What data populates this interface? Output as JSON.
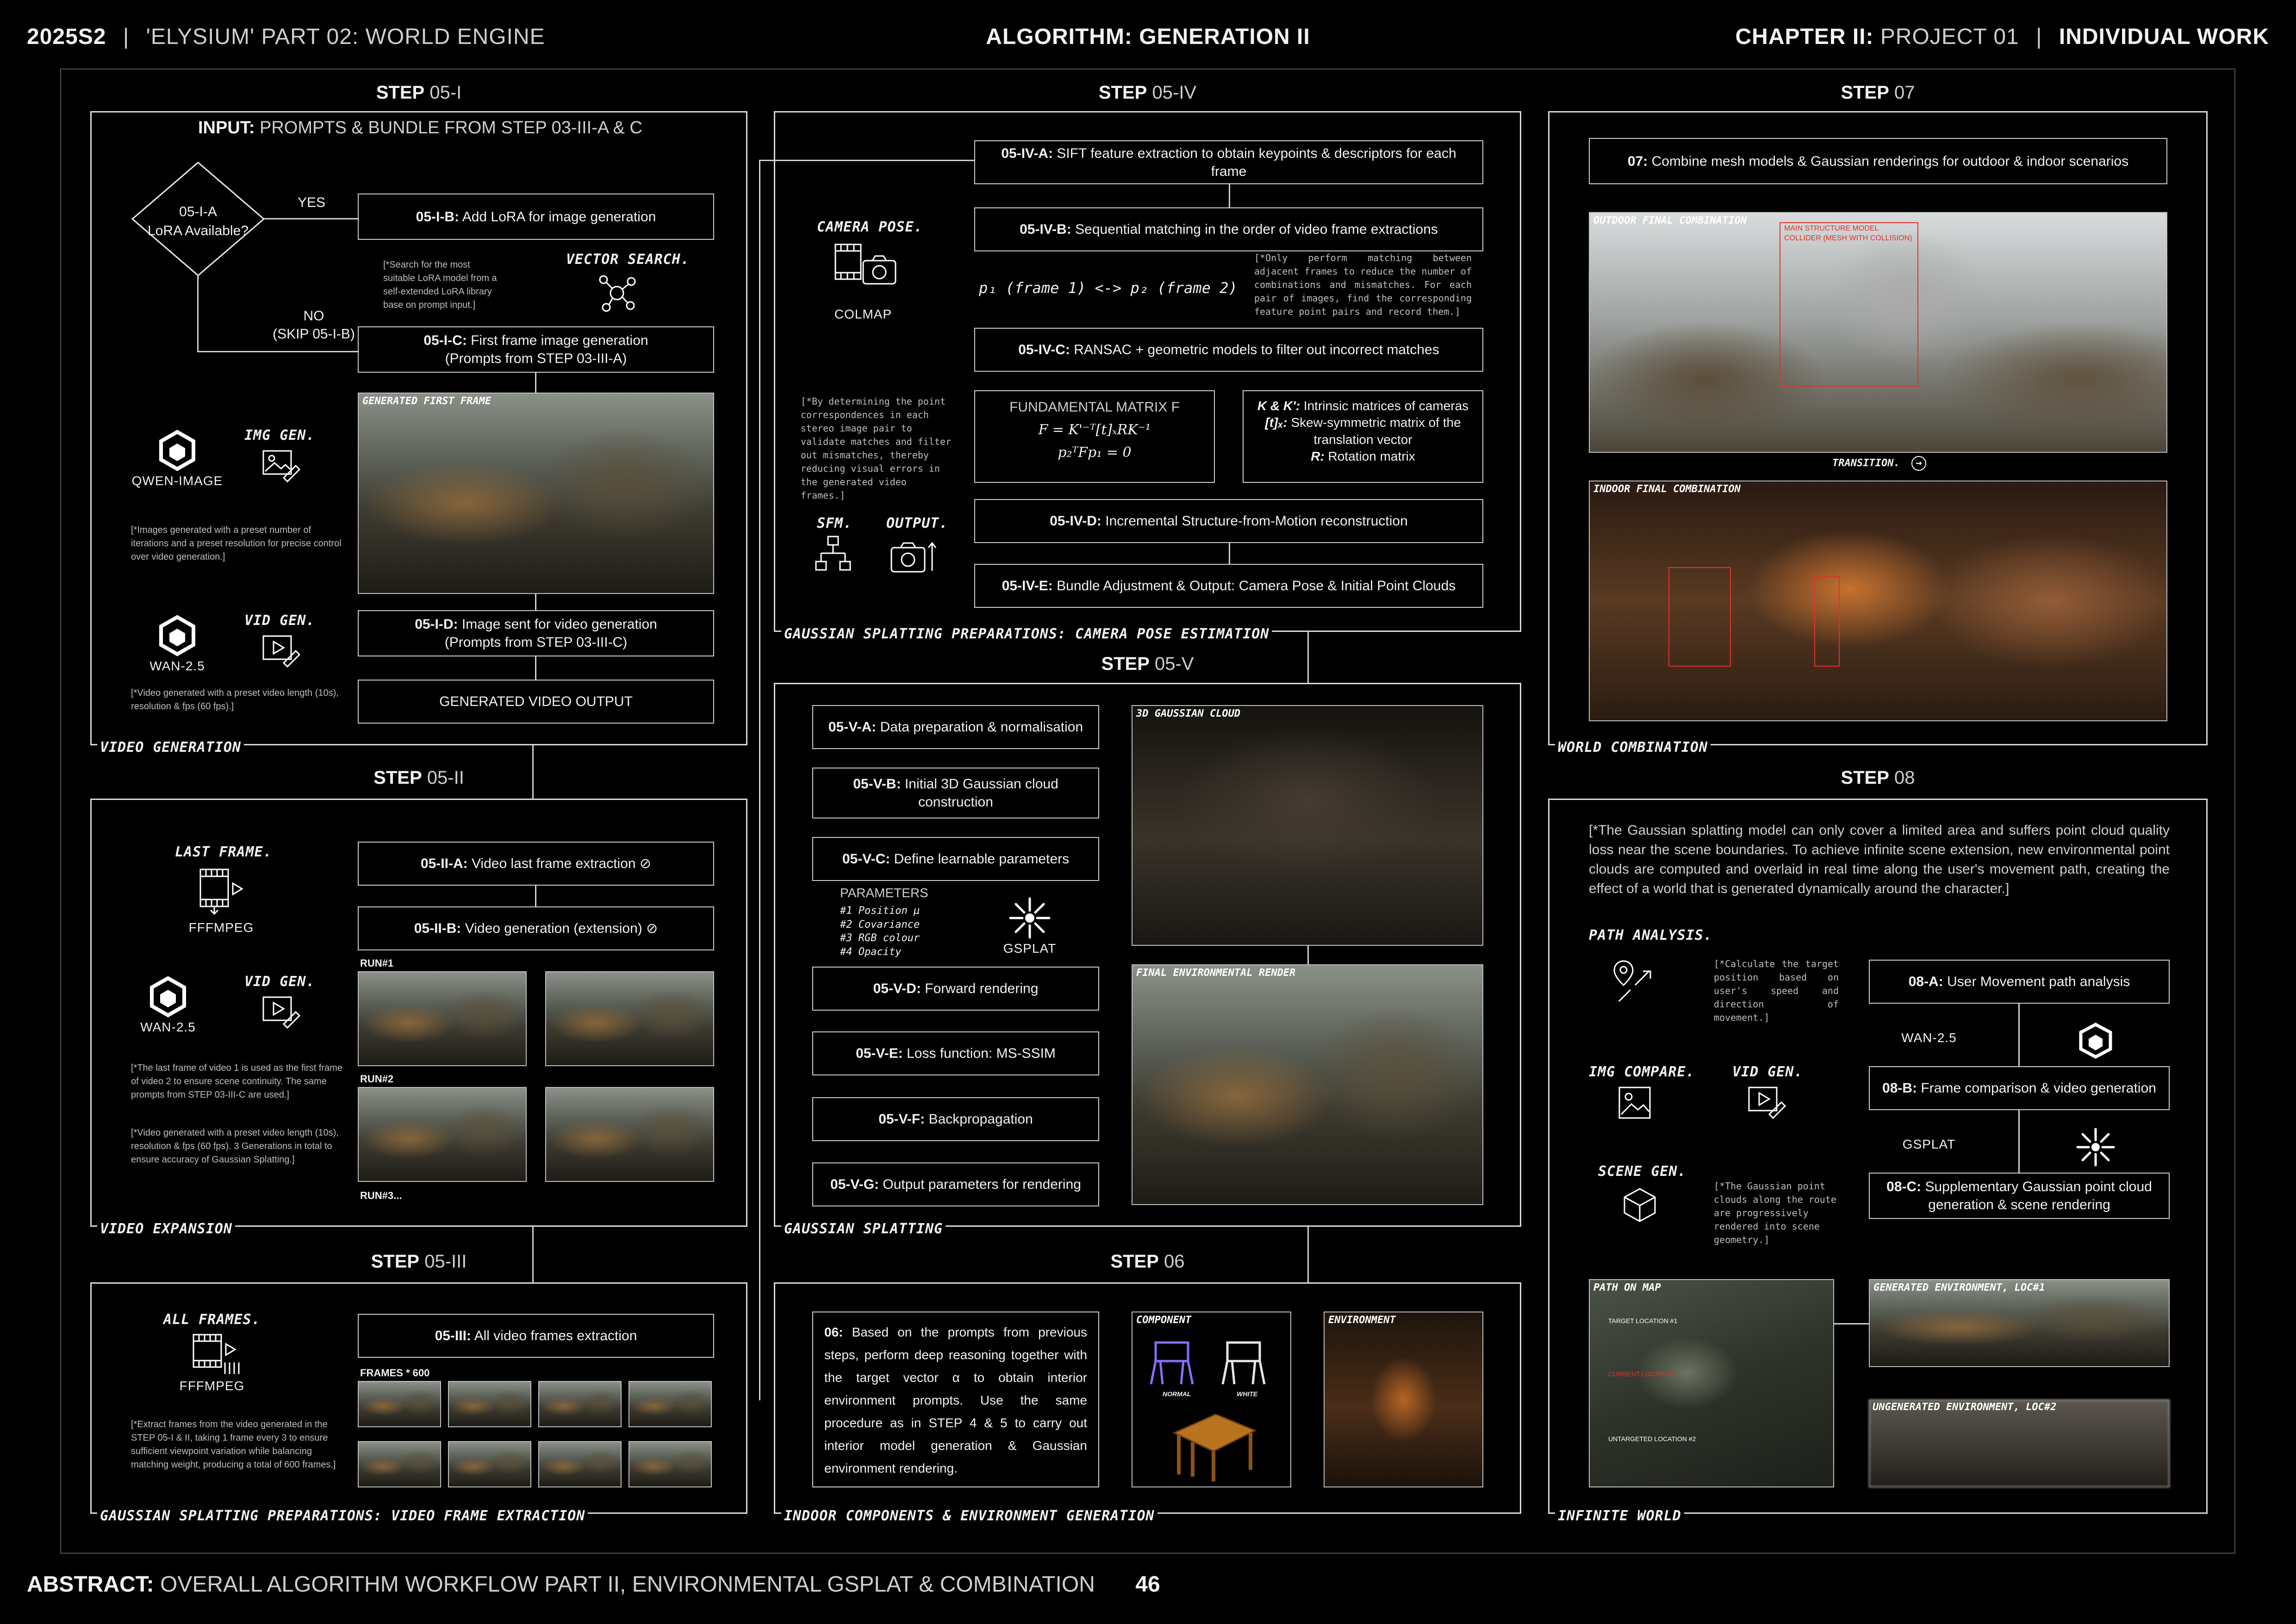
{
  "header": {
    "left_code": "2025S2",
    "left_sep": "|",
    "left_title_bold": "'ELYSIUM' PART 02:",
    "left_title_light": "WORLD ENGINE",
    "center": "ALGORITHM: GENERATION II",
    "right_bold": "CHAPTER II:",
    "right_light": "PROJECT 01",
    "right_sep": "|",
    "right_tag": "INDIVIDUAL WORK"
  },
  "footer": {
    "abstract_bold": "ABSTRACT:",
    "abstract_text": "OVERALL ALGORITHM WORKFLOW PART II, ENVIRONMENTAL GSPLAT & COMBINATION",
    "page": "46"
  },
  "step_05_i": {
    "step": "STEP",
    "num": "05-I",
    "input_bold": "INPUT:",
    "input_text": "PROMPTS & BUNDLE FROM STEP 03-III-A & C",
    "decision_line1": "05-I-A",
    "decision_line2": "LoRA Available?",
    "yes": "YES",
    "no": "NO",
    "skip": "(SKIP 05-I-B)",
    "box_b_code": "05-I-B:",
    "box_b_text": "Add LoRA for image generation",
    "vector_search": "VECTOR SEARCH.",
    "lora_note": "[*Search for the most suitable LoRA model from a self-extended LoRA library base on prompt input.]",
    "box_c_code": "05-I-C:",
    "box_c_text": "First frame image generation",
    "box_c_sub": "(Prompts from STEP 03-III-A)",
    "img_tag": "GENERATED FIRST FRAME",
    "qwen": "QWEN-IMAGE",
    "img_gen": "IMG GEN.",
    "img_note": "[*Images generated with a preset number of iterations and a preset resolution for precise control over video generation.]",
    "wan": "WAN-2.5",
    "vid_gen": "VID GEN.",
    "box_d_code": "05-I-D:",
    "box_d_text": "Image sent for video generation",
    "box_d_sub": "(Prompts from STEP 03-III-C)",
    "vid_note": "[*Video generated with a preset video length (10s), resolution & fps (60 fps).]",
    "output": "GENERATED VIDEO OUTPUT",
    "footer": "VIDEO GENERATION"
  },
  "step_05_ii": {
    "step": "STEP",
    "num": "05-II",
    "last_frame": "LAST FRAME.",
    "ffmpeg": "FFFMPEG",
    "vid_gen": "VID GEN.",
    "wan": "WAN-2.5",
    "box_a_code": "05-II-A:",
    "box_a_text": "Video last frame extraction",
    "box_b_code": "05-II-B:",
    "box_b_text": "Video generation (extension)",
    "run1": "RUN#1",
    "run2": "RUN#2",
    "run3": "RUN#3...",
    "note1": "[*The last frame of video 1 is used as the first frame of video 2 to ensure scene continuity. The same prompts from STEP 03-III-C are used.]",
    "note2": "[*Video generated with a preset video length (10s), resolution & fps (60 fps). 3 Generations in total to ensure accuracy of Gaussian Splatting.]",
    "footer": "VIDEO EXPANSION"
  },
  "step_05_iii": {
    "step": "STEP",
    "num": "05-III",
    "all_frames": "ALL FRAMES.",
    "ffmpeg": "FFFMPEG",
    "box_code": "05-III:",
    "box_text": "All video frames extraction",
    "frames_label": "FRAMES * 600",
    "note": "[*Extract frames from the video generated in the STEP 05-I & II, taking 1 frame every 3 to ensure sufficient viewpoint variation while balancing matching weight, producing a total of 600 frames.]",
    "footer": "GAUSSIAN SPLATTING PREPARATIONS: VIDEO FRAME EXTRACTION"
  },
  "step_05_iv": {
    "step": "STEP",
    "num": "05-IV",
    "camera_pose": "CAMERA POSE.",
    "colmap": "COLMAP",
    "box_a_code": "05-IV-A:",
    "box_a_text": "SIFT feature extraction to obtain keypoints & descriptors for each frame",
    "box_b_code": "05-IV-B:",
    "box_b_text": "Sequential matching in the order of video frame extractions",
    "pair_formula": "p₁ (frame 1) <-> p₂ (frame 2)",
    "match_note": "[*Only perform matching between adjacent frames to reduce the number of combinations and mismatches. For each pair of images, find the corresponding feature point pairs and record them.]",
    "box_c_code": "05-IV-C:",
    "box_c_text": "RANSAC + geometric models to filter out incorrect matches",
    "ransac_note": "[*By determining the point correspondences in each stereo image pair to validate matches and filter out mismatches, thereby reducing visual errors in the generated video frames.]",
    "fm_title": "FUNDAMENTAL MATRIX F",
    "fm_eq1": "F = K'⁻ᵀ[t]ₓRK⁻¹",
    "fm_eq2": "p₂ᵀFp₁ = 0",
    "k_bold": "K & K':",
    "k_text": "Intrinsic matrices of cameras",
    "t_bold": "[t]ₓ:",
    "t_text": "Skew-symmetric matrix of the translation vector",
    "r_bold": "R:",
    "r_text": "Rotation matrix",
    "sfm": "SFM.",
    "output": "OUTPUT.",
    "box_d_code": "05-IV-D:",
    "box_d_text": "Incremental Structure-from-Motion reconstruction",
    "box_e_code": "05-IV-E:",
    "box_e_text": "Bundle Adjustment & Output: Camera Pose & Initial Point Clouds",
    "footer": "GAUSSIAN SPLATTING PREPARATIONS: CAMERA POSE ESTIMATION"
  },
  "step_05_v": {
    "step": "STEP",
    "num": "05-V",
    "boxes": [
      {
        "code": "05-V-A:",
        "text": "Data preparation & normalisation"
      },
      {
        "code": "05-V-B:",
        "text": "Initial 3D Gaussian cloud construction"
      },
      {
        "code": "05-V-C:",
        "text": "Define learnable parameters"
      },
      {
        "code": "05-V-D:",
        "text": "Forward rendering"
      },
      {
        "code": "05-V-E:",
        "text": "Loss function: MS-SSIM"
      },
      {
        "code": "05-V-F:",
        "text": "Backpropagation"
      },
      {
        "code": "05-V-G:",
        "text": "Output parameters for rendering"
      }
    ],
    "params_title": "PARAMETERS",
    "params": [
      "#1 Position μ",
      "#2 Covariance",
      "#3 RGB colour",
      "#4 Opacity"
    ],
    "gsplat": "GSPLAT",
    "img_cloud": "3D GAUSSIAN CLOUD",
    "img_final": "FINAL ENVIRONMENTAL RENDER",
    "footer": "GAUSSIAN SPLATTING"
  },
  "step_06": {
    "step": "STEP",
    "num": "06",
    "text_code": "06:",
    "text": "Based on the prompts from previous steps, perform deep reasoning together with the target vector α to obtain interior environment prompts. Use the same procedure as in STEP 4 & 5 to carry out interior model generation & Gaussian environment rendering.",
    "component": "COMPONENT",
    "normal": "NORMAL",
    "white": "WHITE",
    "environment": "ENVIRONMENT",
    "footer": "INDOOR COMPONENTS & ENVIRONMENT GENERATION"
  },
  "step_07": {
    "step": "STEP",
    "num": "07",
    "box_code": "07:",
    "box_text": "Combine mesh models & Gaussian renderings for outdoor & indoor scenarios",
    "outdoor_tag": "OUTDOOR FINAL COMBINATION",
    "red_label": "MAIN STRUCTURE MODEL COLLIDER (MESH WITH COLLISION)",
    "transition": "TRANSITION.",
    "indoor_tag": "INDOOR FINAL COMBINATION",
    "footer": "WORLD COMBINATION"
  },
  "step_08": {
    "step": "STEP",
    "num": "08",
    "intro": "[*The Gaussian splatting model can only cover a limited area and suffers point cloud quality loss near the scene boundaries. To achieve infinite scene extension, new environmental point clouds are computed and overlaid in real time along the user's movement path, creating the effect of a world that is generated dynamically around the character.]",
    "path_analysis": "PATH ANALYSIS.",
    "path_note": "[*Calculate the target position based on user's speed and direction of movement.]",
    "box_a_code": "08-A:",
    "box_a_text": "User Movement path analysis",
    "wan": "WAN-2.5",
    "img_compare": "IMG COMPARE.",
    "vid_gen": "VID GEN.",
    "box_b_code": "08-B:",
    "box_b_text": "Frame comparison & video generation",
    "gsplat": "GSPLAT",
    "scene_gen": "SCENE GEN.",
    "scene_note": "[*The Gaussian point clouds along the route are progressively rendered into scene geometry.]",
    "box_c_code": "08-C:",
    "box_c_text": "Supplementary Gaussian point cloud generation & scene rendering",
    "map_tag": "PATH ON MAP",
    "map_t1": "TARGET LOCATION #1",
    "map_cur": "CURRENT LOCATION",
    "map_t2": "UNTARGETED LOCATION #2",
    "gen_tag": "GENERATED ENVIRONMENT, LOC#1",
    "ungen_tag": "UNGENERATED ENVIRONMENT, LOC#2",
    "footer": "INFINITE WORLD"
  }
}
